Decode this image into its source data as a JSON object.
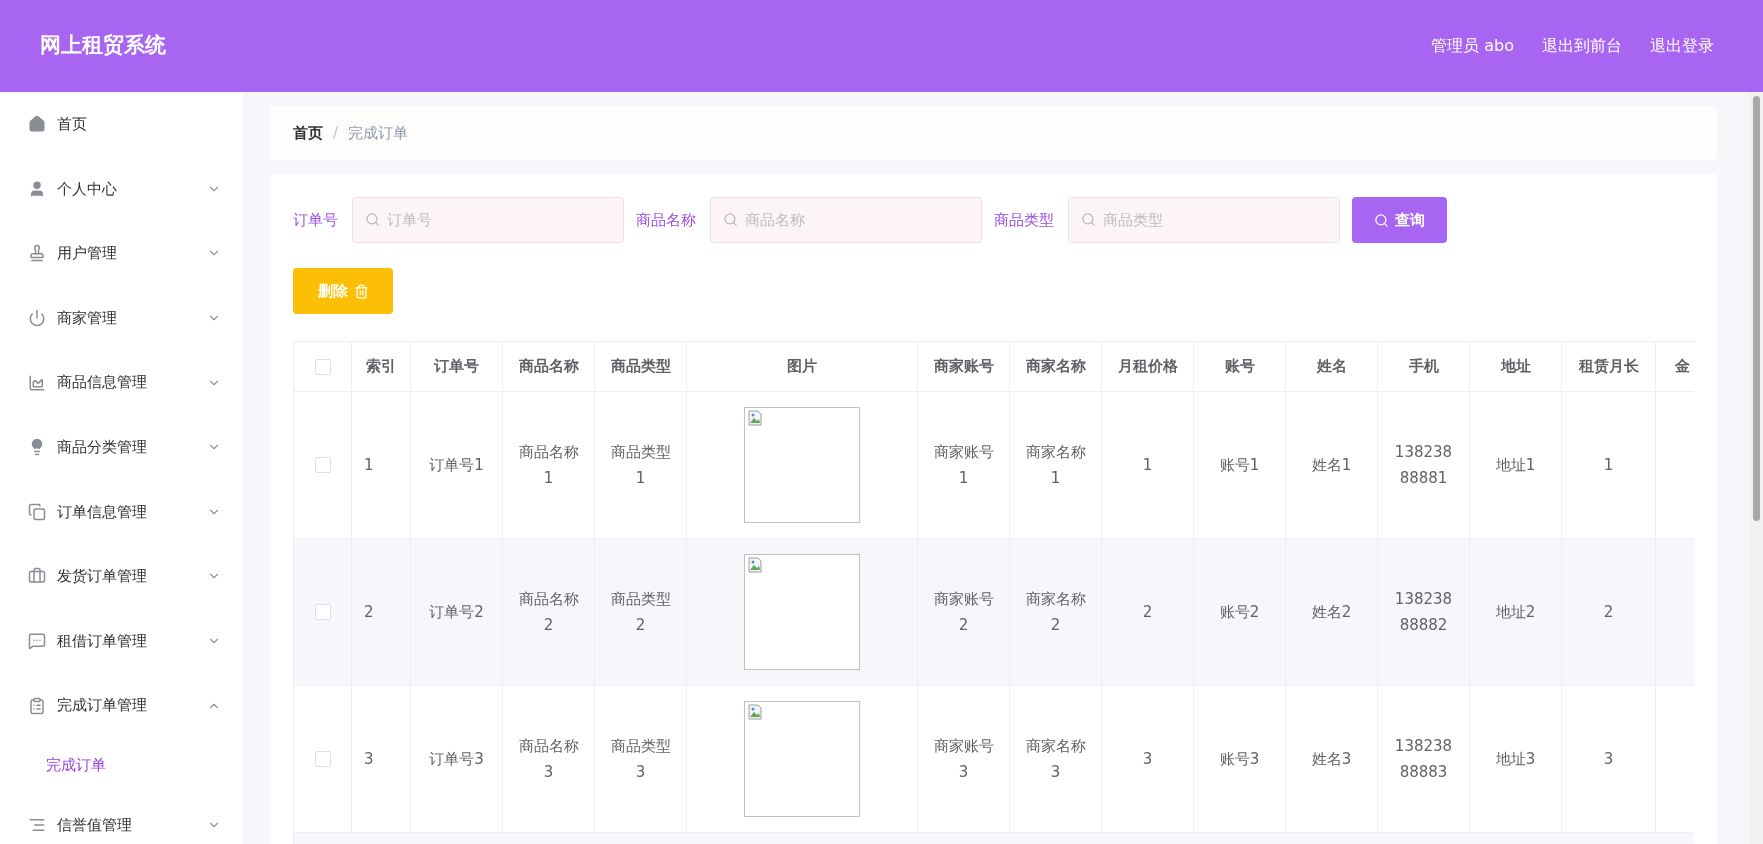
{
  "header": {
    "title": "网上租贸系统",
    "links": [
      "管理员 abo",
      "退出到前台",
      "退出登录"
    ]
  },
  "sidebar": {
    "items": [
      {
        "label": "首页",
        "kind": "link"
      },
      {
        "label": "个人中心",
        "kind": "menu",
        "expanded": false
      },
      {
        "label": "用户管理",
        "kind": "menu",
        "expanded": false
      },
      {
        "label": "商家管理",
        "kind": "menu",
        "expanded": false
      },
      {
        "label": "商品信息管理",
        "kind": "menu",
        "expanded": false
      },
      {
        "label": "商品分类管理",
        "kind": "menu",
        "expanded": false
      },
      {
        "label": "订单信息管理",
        "kind": "menu",
        "expanded": false
      },
      {
        "label": "发货订单管理",
        "kind": "menu",
        "expanded": false
      },
      {
        "label": "租借订单管理",
        "kind": "menu",
        "expanded": false
      },
      {
        "label": "完成订单管理",
        "kind": "menu",
        "expanded": true,
        "children": [
          {
            "label": "完成订单",
            "selected": true
          }
        ]
      },
      {
        "label": "信誉值管理",
        "kind": "menu",
        "expanded": false
      }
    ]
  },
  "breadcrumb": {
    "items": [
      "首页",
      "完成订单"
    ],
    "separator": "/"
  },
  "search": {
    "fields": [
      {
        "label": "订单号",
        "placeholder": "订单号"
      },
      {
        "label": "商品名称",
        "placeholder": "商品名称"
      },
      {
        "label": "商品类型",
        "placeholder": "商品类型"
      }
    ],
    "button": "查询"
  },
  "delete_button": "删除",
  "table": {
    "header_checkbox": {
      "checked": false
    },
    "columns": [
      {
        "label": "索引",
        "kind": "text"
      },
      {
        "label": "订单号",
        "kind": "text"
      },
      {
        "label": "商品名称",
        "kind": "text"
      },
      {
        "label": "商品类型",
        "kind": "text"
      },
      {
        "label": "图片",
        "kind": "image"
      },
      {
        "label": "商家账号",
        "kind": "text"
      },
      {
        "label": "商家名称",
        "kind": "text"
      },
      {
        "label": "月租价格",
        "kind": "text"
      },
      {
        "label": "账号",
        "kind": "text"
      },
      {
        "label": "姓名",
        "kind": "text"
      },
      {
        "label": "手机",
        "kind": "text"
      },
      {
        "label": "地址",
        "kind": "text"
      },
      {
        "label": "租赁月长",
        "kind": "text"
      },
      {
        "label": "金",
        "kind": "text"
      }
    ],
    "rows": [
      {
        "checked": false,
        "cells": [
          "1",
          "订单号1",
          "商品名称1",
          "商品类型1",
          "",
          "商家账号1",
          "商家名称1",
          "1",
          "账号1",
          "姓名1",
          "13823888881",
          "地址1",
          "1"
        ]
      },
      {
        "checked": false,
        "cells": [
          "2",
          "订单号2",
          "商品名称2",
          "商品类型2",
          "",
          "商家账号2",
          "商家名称2",
          "2",
          "账号2",
          "姓名2",
          "13823888882",
          "地址2",
          "2"
        ]
      },
      {
        "checked": false,
        "cells": [
          "3",
          "订单号3",
          "商品名称3",
          "商品类型3",
          "",
          "商家账号3",
          "商家名称3",
          "3",
          "账号3",
          "姓名3",
          "13823888883",
          "地址3",
          "3"
        ]
      }
    ]
  }
}
